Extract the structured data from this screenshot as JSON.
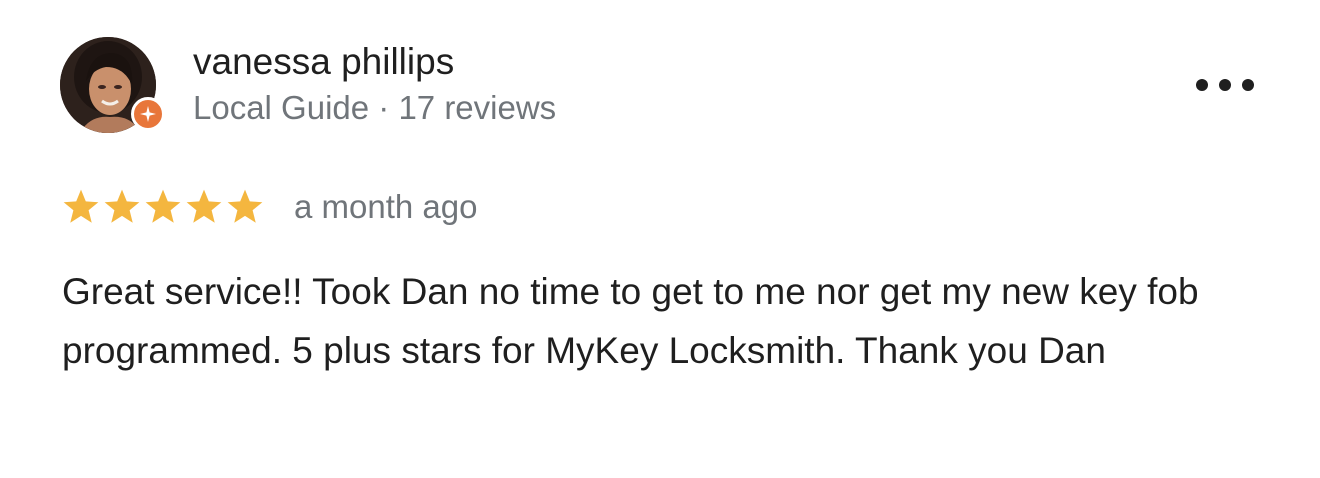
{
  "review": {
    "author_name": "vanessa phillips",
    "author_meta": "Local Guide · 17 reviews",
    "rating": 5,
    "rating_max": 5,
    "time_ago": "a month ago",
    "text": "Great service!! Took Dan no time to get to me nor get my new key fob programmed. 5 plus stars for MyKey Locksmith. Thank you Dan"
  },
  "icons": {
    "avatar": "profile-photo",
    "badge": "local-guide-badge-icon",
    "more": "more-options-icon",
    "star": "star-icon"
  },
  "colors": {
    "star": "#f4b63f",
    "badge": "#e8763a",
    "primary_text": "#1f1f1f",
    "secondary_text": "#70757a"
  }
}
